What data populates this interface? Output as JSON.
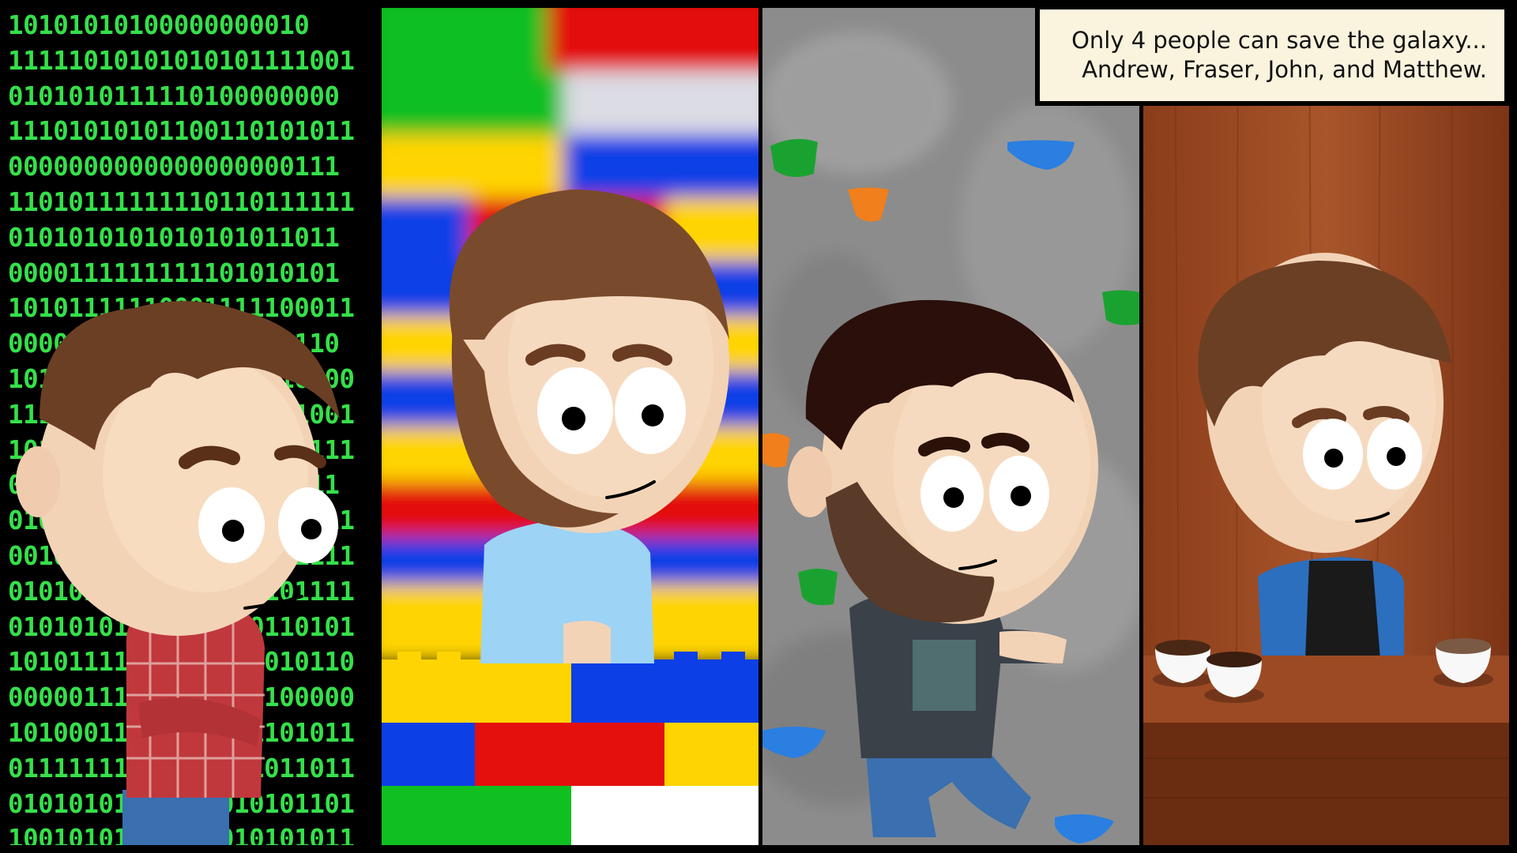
{
  "caption": {
    "line1": "Only 4 people can save the galaxy...",
    "line2": "Andrew, Fraser, John, and Matthew."
  },
  "panel1": {
    "binary_rows": [
      "10101010100000000010",
      "11111010101010101111001",
      "0101010111110100000000",
      "11101010101100110101011",
      "0000000000000000000111",
      "11010111111110110111111",
      "0101010101010101011011",
      "0000111111111101010101",
      "10101111110001111100011",
      "0000000000000000000110",
      "10101010101010101010100",
      "11111010101010101111001",
      "10101010101010101010111",
      "0000000000000000000011",
      "01010111111010000000011",
      "00101010101100110101111",
      "01010101010101010101111",
      "01010101010101010110101",
      "10101111111110101010110",
      "00000111111111111100000",
      "10100011111111111101011",
      "01111111111111111011011",
      "01010101010101010101101",
      "10010101010101010101011"
    ],
    "background_color": "#000000",
    "binary_color": "#35e04a"
  },
  "panel2": {
    "scene": "toy-brick-wall",
    "colors": [
      "#ffd400",
      "#0d3fe6",
      "#e3100e",
      "#10bf20",
      "#ffffff"
    ]
  },
  "panel3": {
    "scene": "climbing-wall",
    "hold_colors": [
      "#1aa230",
      "#f07f1c",
      "#2a7fe0"
    ]
  },
  "panel4": {
    "scene": "coffee-counter",
    "cup_count": 3
  }
}
